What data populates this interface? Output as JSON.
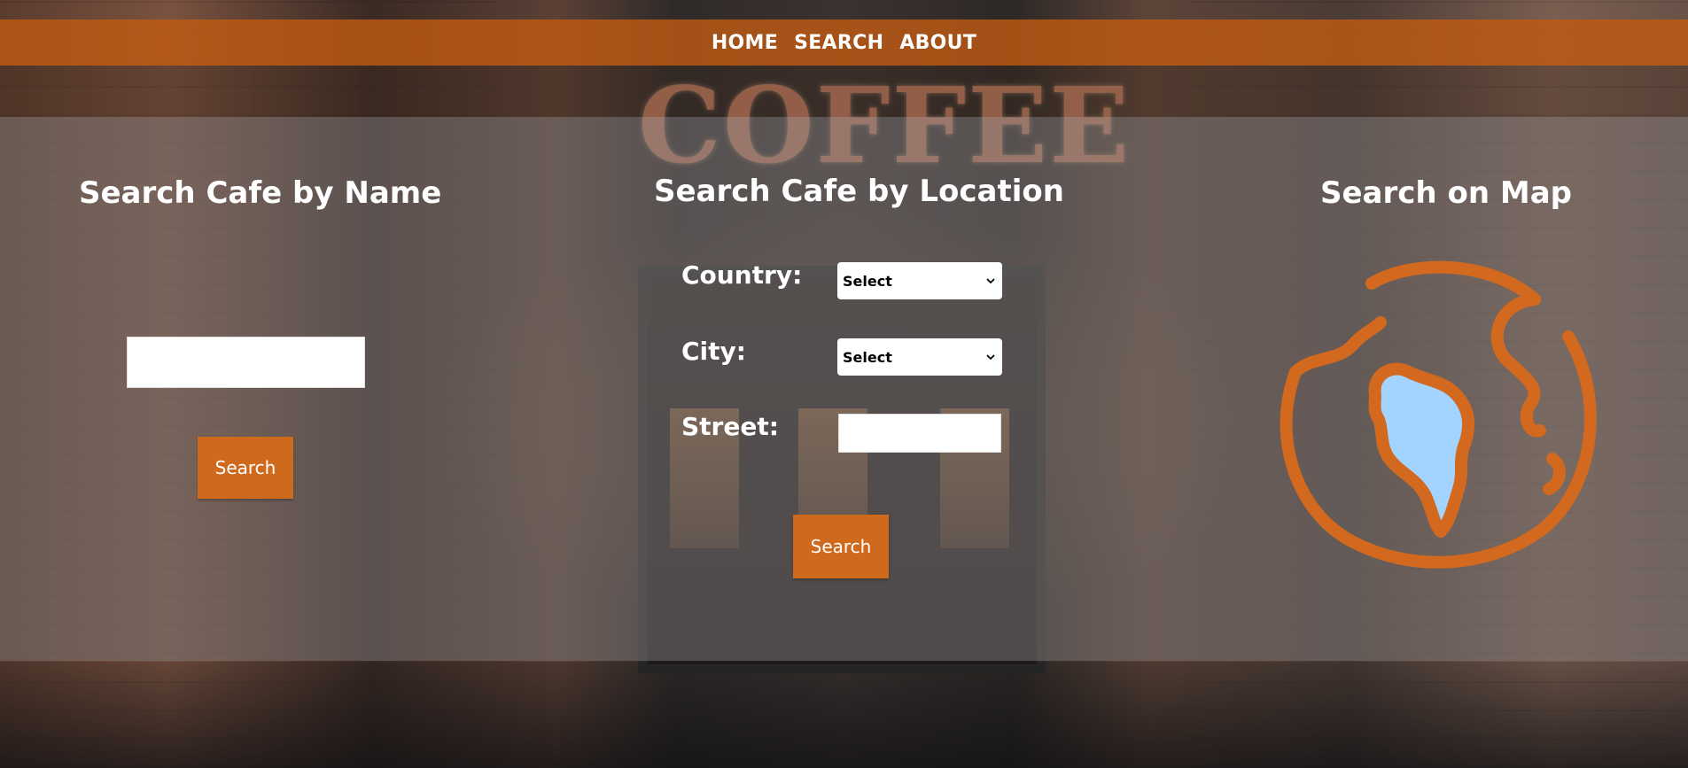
{
  "nav": {
    "items": [
      {
        "label": "HOME"
      },
      {
        "label": "SEARCH"
      },
      {
        "label": "ABOUT"
      }
    ]
  },
  "background": {
    "sign_text": "COFFEE"
  },
  "search_by_name": {
    "title": "Search Cafe by Name",
    "input_value": "",
    "button_label": "Search"
  },
  "search_by_location": {
    "title": "Search Cafe by Location",
    "country_label": "Country:",
    "country_selected": "Select",
    "city_label": "City:",
    "city_selected": "Select",
    "street_label": "Street:",
    "street_value": "",
    "button_label": "Search"
  },
  "search_on_map": {
    "title": "Search on Map",
    "icon": "globe-icon"
  },
  "colors": {
    "accent": "#cf6a1d",
    "globe_stroke": "#d2691e",
    "globe_fill": "#a3d4ff"
  }
}
